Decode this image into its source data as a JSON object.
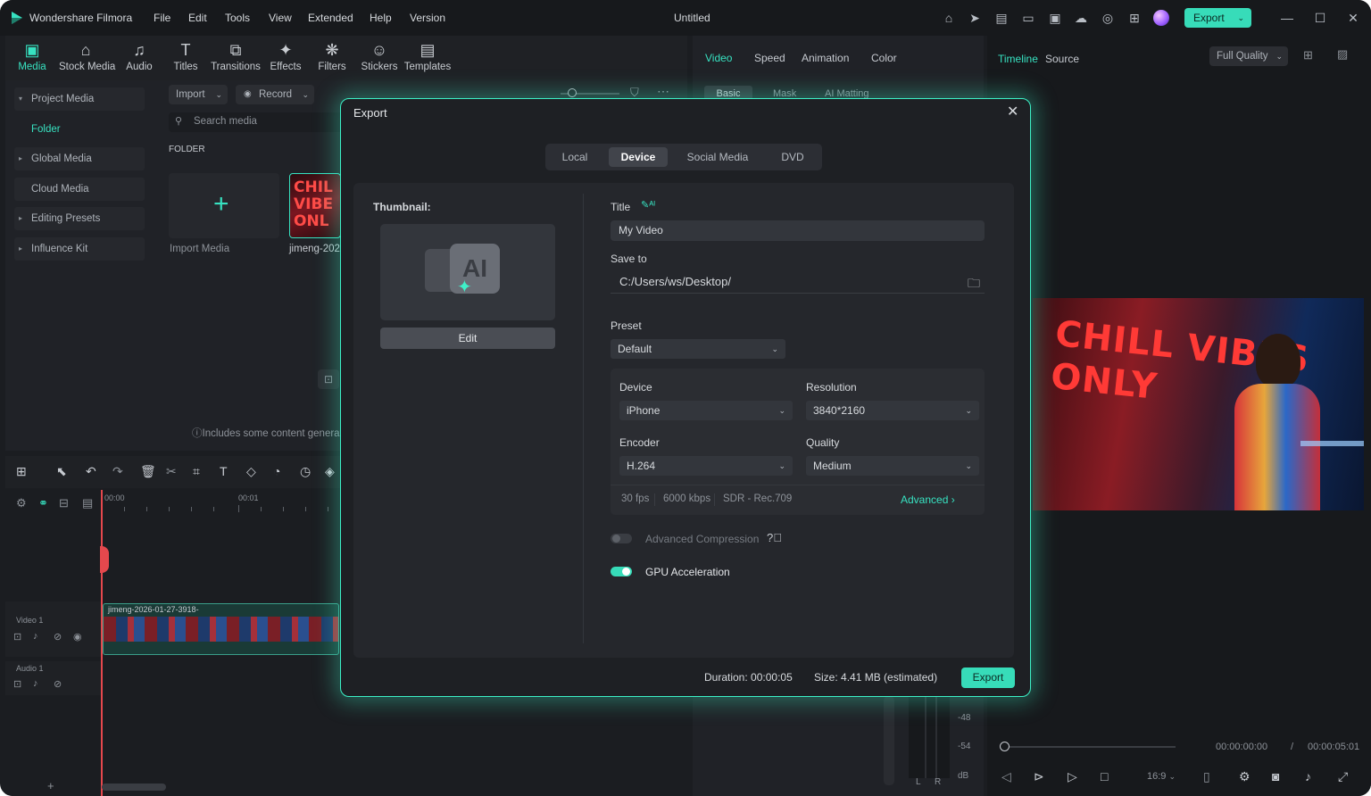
{
  "app": {
    "name": "Wondershare Filmora",
    "document_title": "Untitled",
    "export_label": "Export"
  },
  "menu": [
    "File",
    "Edit",
    "Tools",
    "View",
    "Extended",
    "Help",
    "Version"
  ],
  "toolbar": [
    "Media",
    "Stock Media",
    "Audio",
    "Titles",
    "Transitions",
    "Effects",
    "Filters",
    "Stickers",
    "Templates"
  ],
  "sidebar": {
    "items": [
      {
        "label": "Project Media",
        "caret": "▾"
      },
      {
        "label": "Folder",
        "caret": ""
      },
      {
        "label": "Global Media",
        "caret": "▸"
      },
      {
        "label": "Cloud Media",
        "caret": ""
      },
      {
        "label": "Editing Presets",
        "caret": "▸"
      },
      {
        "label": "Influence Kit",
        "caret": "▸"
      }
    ]
  },
  "media": {
    "import_label": "Import",
    "record_label": "Record",
    "search_placeholder": "Search media",
    "folder_header": "FOLDER",
    "import_media_label": "Import Media",
    "clip_name": "jimeng-202",
    "notice": "Includes some content generat"
  },
  "props_tabs": [
    "Video",
    "Speed",
    "Animation",
    "Color"
  ],
  "props_subtabs": [
    "Basic",
    "Mask",
    "AI Matting"
  ],
  "preview": {
    "tabs": [
      "Timeline",
      "Source"
    ],
    "quality": "Full Quality",
    "poster_text": "CHILL VIBES ONLY",
    "current_time": "00:00:00:00",
    "separator": "/",
    "total_time": "00:00:05:01",
    "aspect": "16:9"
  },
  "timeline": {
    "ruler": [
      "00:00",
      "00:01"
    ],
    "video_track": "Video 1",
    "audio_track": "Audio 1",
    "clip_label": "jimeng-2026-01-27-3918-",
    "meter": [
      "-48",
      "-54",
      "dB",
      "L",
      "R"
    ]
  },
  "export": {
    "title": "Export",
    "tabs": [
      "Local",
      "Device",
      "Social Media",
      "DVD"
    ],
    "active_tab": "Device",
    "thumbnail_label": "Thumbnail:",
    "edit_label": "Edit",
    "title_label": "Title",
    "title_value": "My Video",
    "save_to_label": "Save to",
    "save_to_value": "C:/Users/ws/Desktop/",
    "preset_label": "Preset",
    "preset_value": "Default",
    "device_label": "Device",
    "device_value": "iPhone",
    "resolution_label": "Resolution",
    "resolution_value": "3840*2160",
    "encoder_label": "Encoder",
    "encoder_value": "H.264",
    "quality_label": "Quality",
    "quality_value": "Medium",
    "fps": "30 fps",
    "bitrate": "6000 kbps",
    "color": "SDR - Rec.709",
    "advanced_label": "Advanced",
    "adv_compression_label": "Advanced Compression",
    "adv_compression_on": false,
    "gpu_label": "GPU Acceleration",
    "gpu_on": true,
    "duration_label": "Duration:",
    "duration_value": "00:00:05",
    "size_label": "Size:",
    "size_value": "4.41 MB (estimated)",
    "export_button": "Export"
  },
  "colors": {
    "accent": "#37e2c1",
    "background": "#1b1d21",
    "dialog_glow": "#3cf0c6"
  }
}
